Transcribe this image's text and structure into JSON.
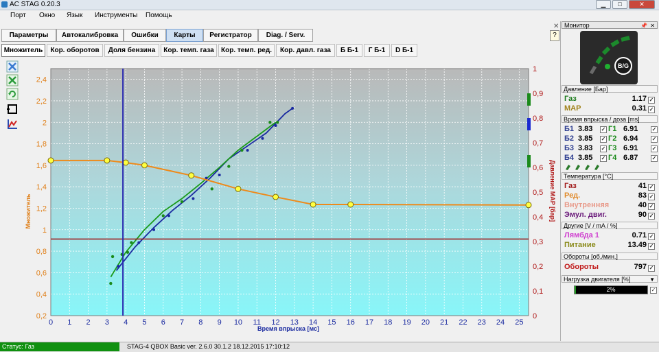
{
  "window": {
    "title": "AC STAG 0.20.3"
  },
  "menu": [
    "Порт",
    "Окно",
    "Язык",
    "Инструменты",
    "Помощь"
  ],
  "tabs_main": [
    "Параметры",
    "Автокалибровка",
    "Ошибки",
    "Карты",
    "Регистратор",
    "Diag. / Serv."
  ],
  "tabs_sub": [
    "Множитель",
    "Кор. оборотов",
    "Доля бензина",
    "Кор. темп. газа",
    "Кор. темп. ред.",
    "Кор. давл. газа",
    "Б Б-1",
    "Г Б-1",
    "D Б-1"
  ],
  "chart_data": {
    "type": "line",
    "xlabel": "Время впрыска [мс]",
    "ylabel": "Множитель",
    "y2label": "Давление MAP [бар]",
    "xlim": [
      0,
      25.5
    ],
    "ylim": [
      0.2,
      2.5
    ],
    "y2lim": [
      0,
      1
    ],
    "x_ticks": [
      "0",
      "1",
      "2",
      "3",
      "4",
      "5",
      "6",
      "7",
      "8",
      "9",
      "10",
      "11",
      "12",
      "13",
      "14",
      "15",
      "16",
      "17",
      "18",
      "19",
      "20",
      "21",
      "22",
      "23",
      "24",
      "25"
    ],
    "y_ticks": [
      "0,2",
      "0,4",
      "0,6",
      "0,8",
      "1",
      "1,2",
      "1,4",
      "1,6",
      "1,8",
      "2",
      "2,2",
      "2,4"
    ],
    "y2_ticks": [
      "0",
      "0,1",
      "0,2",
      "0,3",
      "0,4",
      "0,5",
      "0,6",
      "0,7",
      "0,8",
      "0,9",
      "1"
    ],
    "series": [
      {
        "color": "#ee8a1a",
        "points": [
          [
            0,
            1.645
          ],
          [
            3,
            1.645
          ],
          [
            4,
            1.625
          ],
          [
            5,
            1.6
          ],
          [
            7.5,
            1.505
          ],
          [
            10,
            1.38
          ],
          [
            12,
            1.305
          ],
          [
            14,
            1.235
          ],
          [
            16,
            1.235
          ],
          [
            25.5,
            1.23
          ]
        ]
      },
      {
        "color": "#1a2aa0",
        "points": [
          [
            3.5,
            0.62
          ],
          [
            4.5,
            0.84
          ],
          [
            5.5,
            1.02
          ],
          [
            6.5,
            1.18
          ],
          [
            7.5,
            1.32
          ],
          [
            8.5,
            1.48
          ],
          [
            9.5,
            1.66
          ],
          [
            10.5,
            1.78
          ],
          [
            11.5,
            1.9
          ],
          [
            12.5,
            2.08
          ],
          [
            12.9,
            2.13
          ]
        ]
      },
      {
        "color": "#1a9a1a",
        "points": [
          [
            3.2,
            0.56
          ],
          [
            4,
            0.79
          ],
          [
            5,
            1.0
          ],
          [
            6,
            1.17
          ],
          [
            7,
            1.29
          ],
          [
            8,
            1.43
          ],
          [
            9,
            1.58
          ],
          [
            10,
            1.74
          ],
          [
            11,
            1.87
          ],
          [
            12,
            2.0
          ]
        ]
      }
    ],
    "scatter_green": [
      [
        3.3,
        0.75
      ],
      [
        3.8,
        0.77
      ],
      [
        4.1,
        0.79
      ],
      [
        4.3,
        0.88
      ],
      [
        6,
        1.13
      ],
      [
        7,
        1.26
      ],
      [
        8.6,
        1.38
      ],
      [
        9.5,
        1.59
      ],
      [
        10.2,
        1.74
      ],
      [
        11.7,
        2.0
      ],
      [
        12.1,
        2.0
      ],
      [
        3.2,
        0.5
      ]
    ],
    "scatter_blue": [
      [
        3.6,
        0.66
      ],
      [
        4.7,
        0.88
      ],
      [
        5.5,
        1.0
      ],
      [
        6.3,
        1.13
      ],
      [
        7.6,
        1.29
      ],
      [
        8.3,
        1.48
      ],
      [
        9,
        1.51
      ],
      [
        10.5,
        1.74
      ],
      [
        11.3,
        1.85
      ],
      [
        12,
        1.97
      ],
      [
        12.9,
        2.13
      ]
    ],
    "vline_x": 3.85,
    "hline_y2": 0.31
  },
  "status": {
    "left": "Статус: Газ",
    "right": "STAG-4 QBOX Basic  ver. 2.6.0  30.1.2   18.12.2015 17:10:12"
  },
  "monitor": {
    "title": "Монитор",
    "gauge_label": "B/G",
    "sec_pressure": "Давление [Бар]",
    "gas_label": "Газ",
    "gas_val": "1.17",
    "map_label": "MAP",
    "map_val": "0.31",
    "sec_inj": "Время впрыска / доза [ms]",
    "inj": [
      {
        "b": "Б1",
        "bv": "3.83",
        "g": "Г1",
        "gv": "6.91"
      },
      {
        "b": "Б2",
        "bv": "3.85",
        "g": "Г2",
        "gv": "6.94"
      },
      {
        "b": "Б3",
        "bv": "3.83",
        "g": "Г3",
        "gv": "6.91"
      },
      {
        "b": "Б4",
        "bv": "3.85",
        "g": "Г4",
        "gv": "6.87"
      }
    ],
    "sec_temp": "Температура [°С]",
    "t_gas_label": "Газ",
    "t_gas_val": "41",
    "t_red_label": "Ред.",
    "t_red_val": "83",
    "t_int_label": "Внутренняя",
    "t_int_val": "40",
    "t_emu_label": "Эмул. двиг.",
    "t_emu_val": "90",
    "sec_other": "Другие [V / mA / %]",
    "lambda_label": "Лямбда 1",
    "lambda_val": "0.71",
    "power_label": "Питание",
    "power_val": "13.49",
    "sec_rpm": "Обороты [об./мин.]",
    "rpm_label": "Обороты",
    "rpm_val": "797",
    "sec_load": "Нагрузка двигателя [%]",
    "load_val": "2%",
    "load_fraction": 0.02
  }
}
